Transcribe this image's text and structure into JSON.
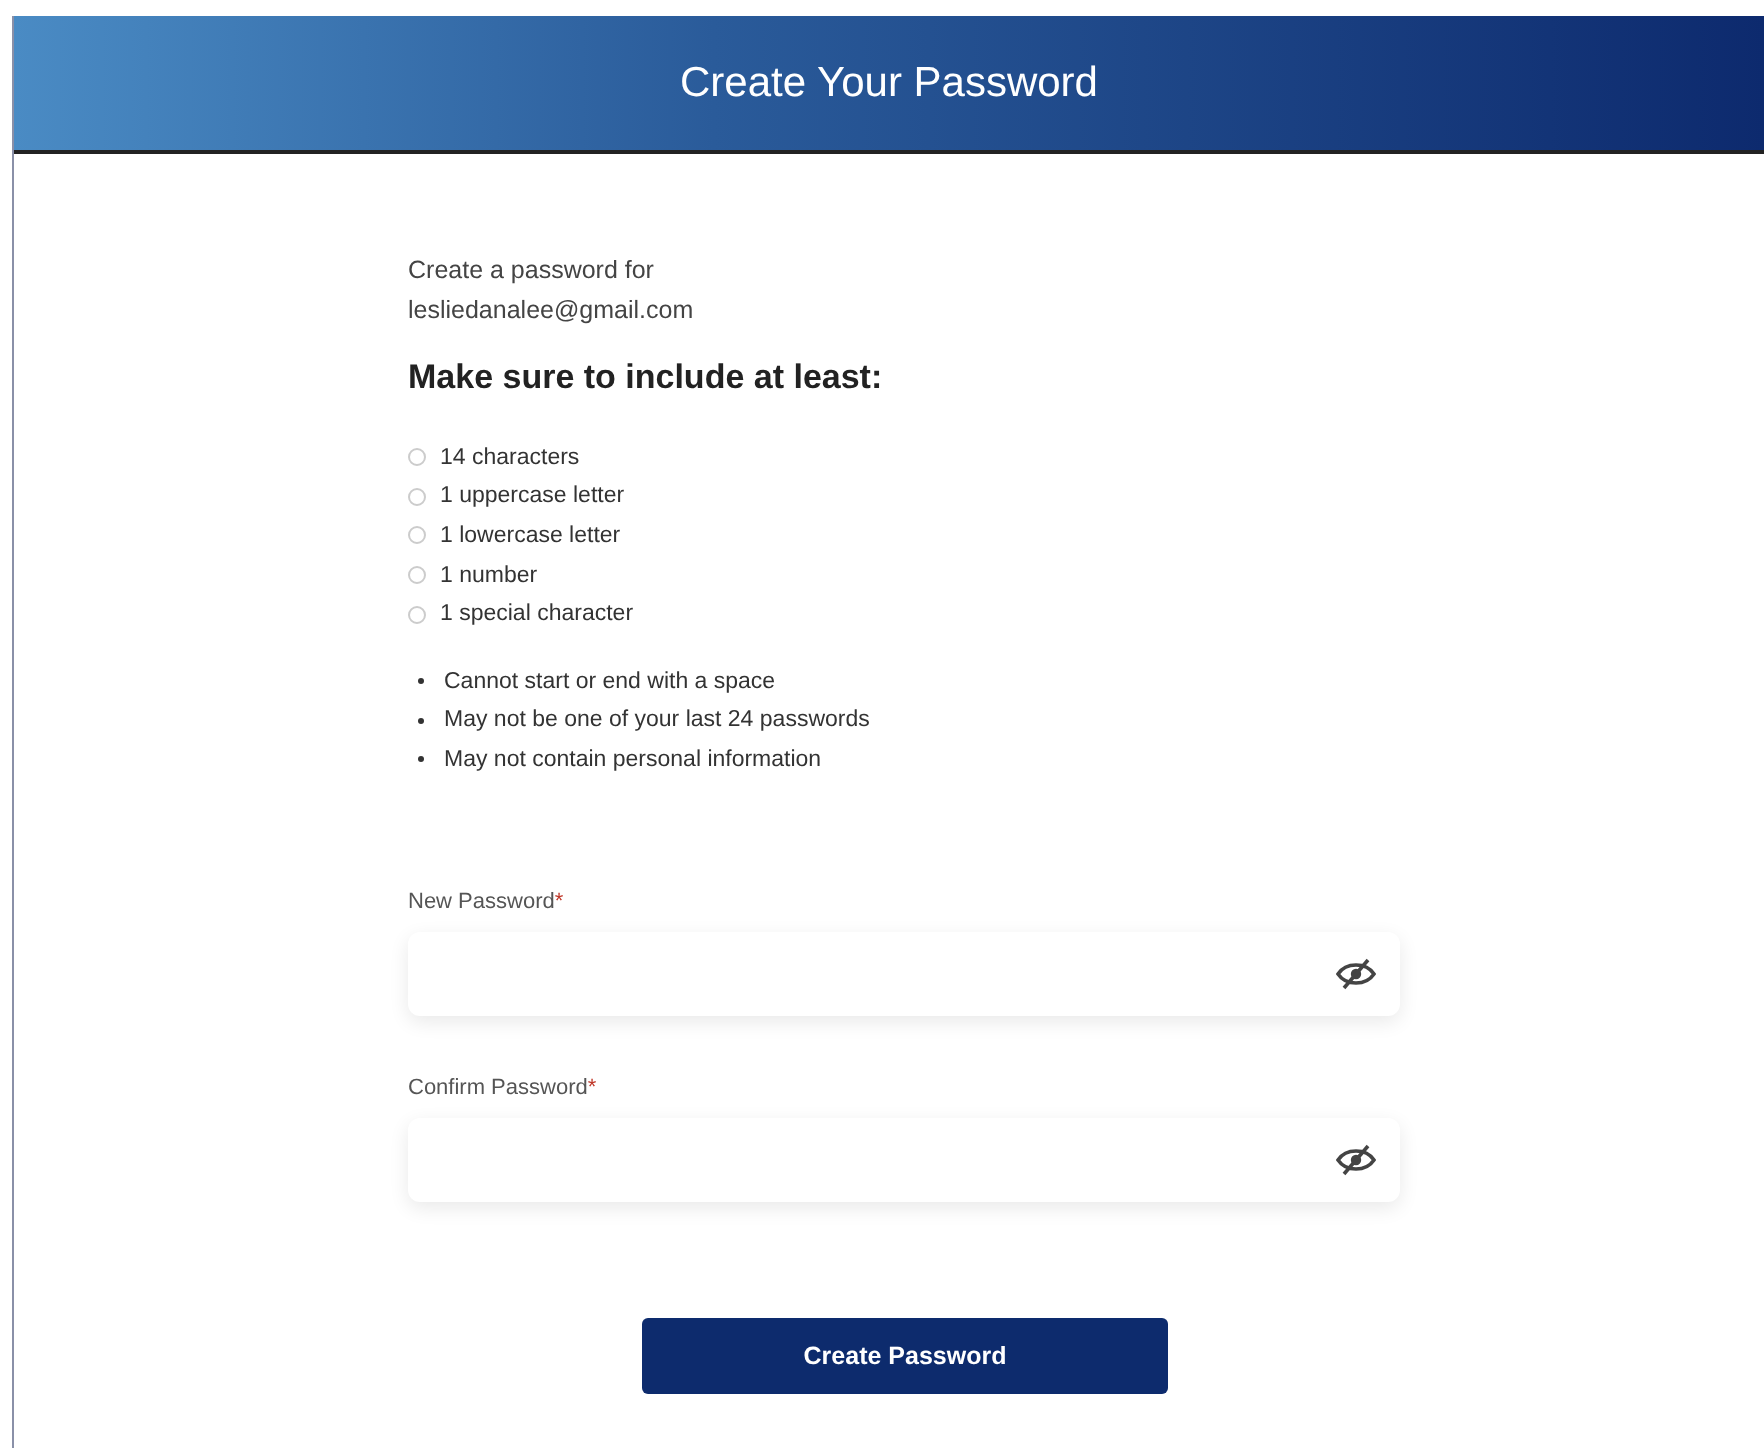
{
  "header": {
    "title": "Create Your Password"
  },
  "intro": {
    "line_1": "Create a password for",
    "email": "lesliedanalee@gmail.com"
  },
  "heading": "Make sure to include at least:",
  "requirements": [
    {
      "label": "14 characters",
      "checked": false
    },
    {
      "label": "1 uppercase letter",
      "checked": false
    },
    {
      "label": "1 lowercase letter",
      "checked": false
    },
    {
      "label": "1 number",
      "checked": false
    },
    {
      "label": "1 special character",
      "checked": false
    }
  ],
  "rules": [
    "Cannot start or end with a space",
    "May not be one of your last 24 passwords",
    "May not contain personal information"
  ],
  "fields": [
    {
      "label": "New Password",
      "required_mark": "*"
    },
    {
      "label": "Confirm Password",
      "required_mark": "*"
    }
  ],
  "submit_button": "Create Password"
}
